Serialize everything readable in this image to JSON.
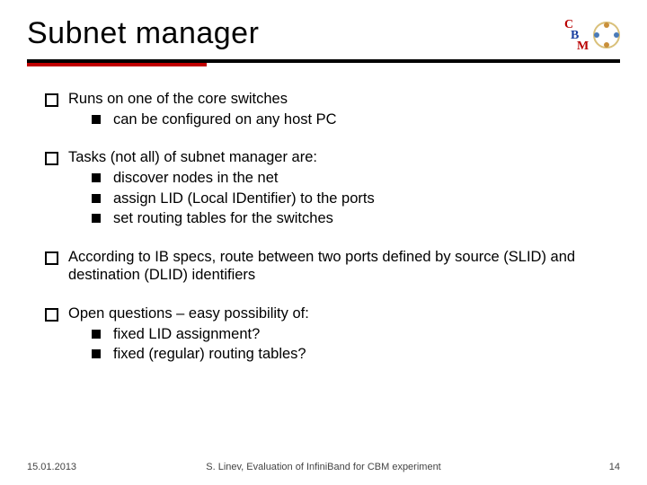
{
  "title": "Subnet manager",
  "logo": {
    "c": "C",
    "b": "B",
    "m": "M"
  },
  "bullets": {
    "b1": "Runs on one of the core switches",
    "b1_1": "can be configured on any host PC",
    "b2": "Tasks (not all) of subnet manager are:",
    "b2_1": "discover nodes in the net",
    "b2_2": "assign LID (Local IDentifier) to the ports",
    "b2_3": "set routing tables for the switches",
    "b3": "According to IB specs, route between two ports defined by source (SLID) and destination (DLID) identifiers",
    "b4": "Open questions – easy possibility of:",
    "b4_1": "fixed LID assignment?",
    "b4_2": "fixed (regular) routing tables?"
  },
  "footer": {
    "date": "15.01.2013",
    "center": "S. Linev, Evaluation of InfiniBand for CBM experiment",
    "page": "14"
  }
}
